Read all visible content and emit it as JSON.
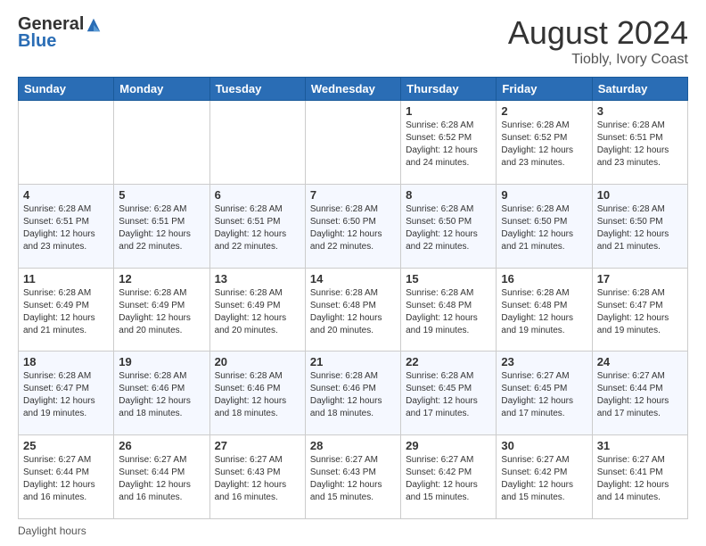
{
  "header": {
    "logo_general": "General",
    "logo_blue": "Blue",
    "month_title": "August 2024",
    "location": "Tiobly, Ivory Coast"
  },
  "footer": {
    "label": "Daylight hours"
  },
  "weekdays": [
    "Sunday",
    "Monday",
    "Tuesday",
    "Wednesday",
    "Thursday",
    "Friday",
    "Saturday"
  ],
  "weeks": [
    [
      {
        "day": "",
        "info": ""
      },
      {
        "day": "",
        "info": ""
      },
      {
        "day": "",
        "info": ""
      },
      {
        "day": "",
        "info": ""
      },
      {
        "day": "1",
        "info": "Sunrise: 6:28 AM\nSunset: 6:52 PM\nDaylight: 12 hours\nand 24 minutes."
      },
      {
        "day": "2",
        "info": "Sunrise: 6:28 AM\nSunset: 6:52 PM\nDaylight: 12 hours\nand 23 minutes."
      },
      {
        "day": "3",
        "info": "Sunrise: 6:28 AM\nSunset: 6:51 PM\nDaylight: 12 hours\nand 23 minutes."
      }
    ],
    [
      {
        "day": "4",
        "info": "Sunrise: 6:28 AM\nSunset: 6:51 PM\nDaylight: 12 hours\nand 23 minutes."
      },
      {
        "day": "5",
        "info": "Sunrise: 6:28 AM\nSunset: 6:51 PM\nDaylight: 12 hours\nand 22 minutes."
      },
      {
        "day": "6",
        "info": "Sunrise: 6:28 AM\nSunset: 6:51 PM\nDaylight: 12 hours\nand 22 minutes."
      },
      {
        "day": "7",
        "info": "Sunrise: 6:28 AM\nSunset: 6:50 PM\nDaylight: 12 hours\nand 22 minutes."
      },
      {
        "day": "8",
        "info": "Sunrise: 6:28 AM\nSunset: 6:50 PM\nDaylight: 12 hours\nand 22 minutes."
      },
      {
        "day": "9",
        "info": "Sunrise: 6:28 AM\nSunset: 6:50 PM\nDaylight: 12 hours\nand 21 minutes."
      },
      {
        "day": "10",
        "info": "Sunrise: 6:28 AM\nSunset: 6:50 PM\nDaylight: 12 hours\nand 21 minutes."
      }
    ],
    [
      {
        "day": "11",
        "info": "Sunrise: 6:28 AM\nSunset: 6:49 PM\nDaylight: 12 hours\nand 21 minutes."
      },
      {
        "day": "12",
        "info": "Sunrise: 6:28 AM\nSunset: 6:49 PM\nDaylight: 12 hours\nand 20 minutes."
      },
      {
        "day": "13",
        "info": "Sunrise: 6:28 AM\nSunset: 6:49 PM\nDaylight: 12 hours\nand 20 minutes."
      },
      {
        "day": "14",
        "info": "Sunrise: 6:28 AM\nSunset: 6:48 PM\nDaylight: 12 hours\nand 20 minutes."
      },
      {
        "day": "15",
        "info": "Sunrise: 6:28 AM\nSunset: 6:48 PM\nDaylight: 12 hours\nand 19 minutes."
      },
      {
        "day": "16",
        "info": "Sunrise: 6:28 AM\nSunset: 6:48 PM\nDaylight: 12 hours\nand 19 minutes."
      },
      {
        "day": "17",
        "info": "Sunrise: 6:28 AM\nSunset: 6:47 PM\nDaylight: 12 hours\nand 19 minutes."
      }
    ],
    [
      {
        "day": "18",
        "info": "Sunrise: 6:28 AM\nSunset: 6:47 PM\nDaylight: 12 hours\nand 19 minutes."
      },
      {
        "day": "19",
        "info": "Sunrise: 6:28 AM\nSunset: 6:46 PM\nDaylight: 12 hours\nand 18 minutes."
      },
      {
        "day": "20",
        "info": "Sunrise: 6:28 AM\nSunset: 6:46 PM\nDaylight: 12 hours\nand 18 minutes."
      },
      {
        "day": "21",
        "info": "Sunrise: 6:28 AM\nSunset: 6:46 PM\nDaylight: 12 hours\nand 18 minutes."
      },
      {
        "day": "22",
        "info": "Sunrise: 6:28 AM\nSunset: 6:45 PM\nDaylight: 12 hours\nand 17 minutes."
      },
      {
        "day": "23",
        "info": "Sunrise: 6:27 AM\nSunset: 6:45 PM\nDaylight: 12 hours\nand 17 minutes."
      },
      {
        "day": "24",
        "info": "Sunrise: 6:27 AM\nSunset: 6:44 PM\nDaylight: 12 hours\nand 17 minutes."
      }
    ],
    [
      {
        "day": "25",
        "info": "Sunrise: 6:27 AM\nSunset: 6:44 PM\nDaylight: 12 hours\nand 16 minutes."
      },
      {
        "day": "26",
        "info": "Sunrise: 6:27 AM\nSunset: 6:44 PM\nDaylight: 12 hours\nand 16 minutes."
      },
      {
        "day": "27",
        "info": "Sunrise: 6:27 AM\nSunset: 6:43 PM\nDaylight: 12 hours\nand 16 minutes."
      },
      {
        "day": "28",
        "info": "Sunrise: 6:27 AM\nSunset: 6:43 PM\nDaylight: 12 hours\nand 15 minutes."
      },
      {
        "day": "29",
        "info": "Sunrise: 6:27 AM\nSunset: 6:42 PM\nDaylight: 12 hours\nand 15 minutes."
      },
      {
        "day": "30",
        "info": "Sunrise: 6:27 AM\nSunset: 6:42 PM\nDaylight: 12 hours\nand 15 minutes."
      },
      {
        "day": "31",
        "info": "Sunrise: 6:27 AM\nSunset: 6:41 PM\nDaylight: 12 hours\nand 14 minutes."
      }
    ]
  ]
}
